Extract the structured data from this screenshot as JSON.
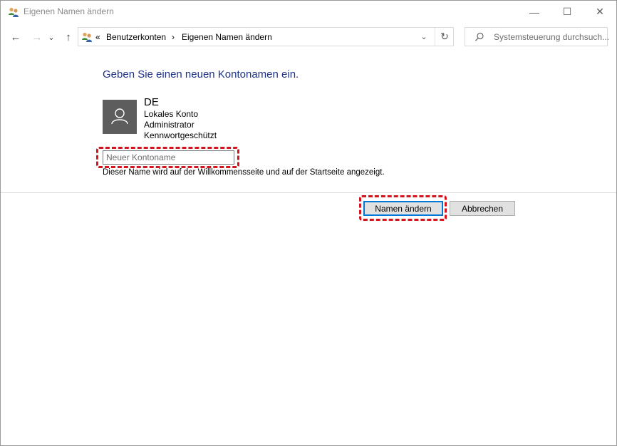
{
  "window": {
    "title": "Eigenen Namen ändern",
    "controls": {
      "minimize": "—",
      "maximize": "☐",
      "close": "✕"
    }
  },
  "nav": {
    "back": "←",
    "forward": "→",
    "recent": "⌄",
    "up": "↑",
    "breadcrumb": {
      "overflow": "«",
      "items": [
        "Benutzerkonten",
        "Eigenen Namen ändern"
      ],
      "separator": "›"
    },
    "dropdown": "⌄",
    "refresh": "↻",
    "search_placeholder": "Systemsteuerung durchsuch..."
  },
  "content": {
    "heading": "Geben Sie einen neuen Kontonamen ein.",
    "account": {
      "name": "DE",
      "details": [
        "Lokales Konto",
        "Administrator",
        "Kennwortgeschützt"
      ]
    },
    "input": {
      "placeholder": "Neuer Kontoname",
      "value": ""
    },
    "hint": "Dieser Name wird auf der Willkommensseite und auf der Startseite angezeigt."
  },
  "buttons": {
    "rename": "Namen ändern",
    "cancel": "Abbrechen"
  },
  "colors": {
    "heading": "#1e3287",
    "highlight": "#d6141c",
    "focus": "#0078d7"
  },
  "icons": [
    "users-icon",
    "back-arrow-icon",
    "forward-arrow-icon",
    "chevron-down-icon",
    "up-arrow-icon",
    "refresh-icon",
    "search-icon",
    "user-avatar-icon"
  ]
}
